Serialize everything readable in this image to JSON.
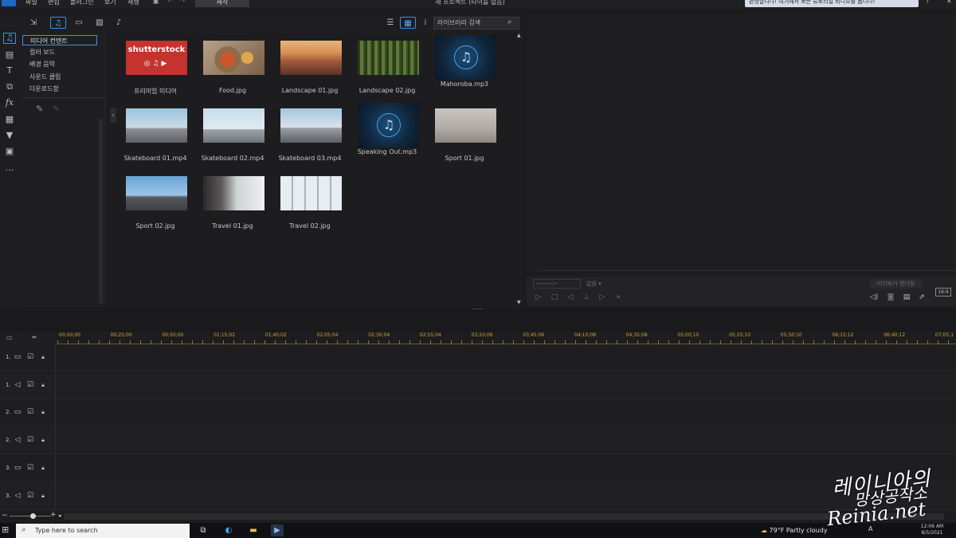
{
  "menubar": {
    "items": [
      "파일",
      "편집",
      "플러그인",
      "보기",
      "재생"
    ],
    "produce_tab": "제작",
    "window_title": "새 프로젝트 (타이틀 없음)",
    "notice": "환영합니다! 여기에서 보든 튜토리얼 비디오를 봅니다!"
  },
  "library": {
    "search_placeholder": "라이브러리 검색",
    "categories": [
      "미디어 컨텐트",
      "컬러 보드",
      "배경 음악",
      "사운드 클립",
      "다운로드함"
    ],
    "items": [
      {
        "caption": "프리미엄 미디어",
        "thumb": "shutterstock",
        "brand": "shutterstock"
      },
      {
        "caption": "Food.jpg",
        "thumb": "food"
      },
      {
        "caption": "Landscape 01.jpg",
        "thumb": "landscape1"
      },
      {
        "caption": "Landscape 02.jpg",
        "thumb": "landscape2"
      },
      {
        "caption": "Mahoroba.mp3",
        "thumb": "music"
      },
      {
        "caption": "Skateboard 01.mp4",
        "thumb": "skate1"
      },
      {
        "caption": "Skateboard 02.mp4",
        "thumb": "skate2"
      },
      {
        "caption": "Skateboard 03.mp4",
        "thumb": "skate3"
      },
      {
        "caption": "Speaking Out.mp3",
        "thumb": "music"
      },
      {
        "caption": "Sport 01.jpg",
        "thumb": "sport1"
      },
      {
        "caption": "Sport 02.jpg",
        "thumb": "sport2"
      },
      {
        "caption": "Travel 01.jpg",
        "thumb": "travel1"
      },
      {
        "caption": "Travel 02.jpg",
        "thumb": "travel2"
      }
    ]
  },
  "preview": {
    "timecode": "--:--:--:--",
    "quality": "없음",
    "render_button": "미리보기 렌더링",
    "aspect": "16:9"
  },
  "timeline": {
    "ticks": [
      "00;00;00",
      "00;25;00",
      "00;50;00",
      "01;15;02",
      "01;40;02",
      "02;05;04",
      "02;30;04",
      "02;55;04",
      "03;20;06",
      "03;45;06",
      "04;10;08",
      "04;35;08",
      "05;00;10",
      "05;25;10",
      "05;50;10",
      "06;15;12",
      "06;40;12",
      "07;05;1"
    ],
    "tracks": [
      {
        "label": "1.",
        "kind": "video"
      },
      {
        "label": "1.",
        "kind": "audio"
      },
      {
        "label": "2.",
        "kind": "video"
      },
      {
        "label": "2.",
        "kind": "audio"
      },
      {
        "label": "3.",
        "kind": "video"
      },
      {
        "label": "3.",
        "kind": "audio"
      }
    ]
  },
  "taskbar": {
    "search_placeholder": "Type here to search",
    "weather": "79°F  Partly cloudy",
    "time": "12:06 AM",
    "date": "8/5/2021"
  },
  "watermark": {
    "line1": "레이니아의",
    "line2": "망상공작소",
    "line3": "Reinia.net"
  }
}
